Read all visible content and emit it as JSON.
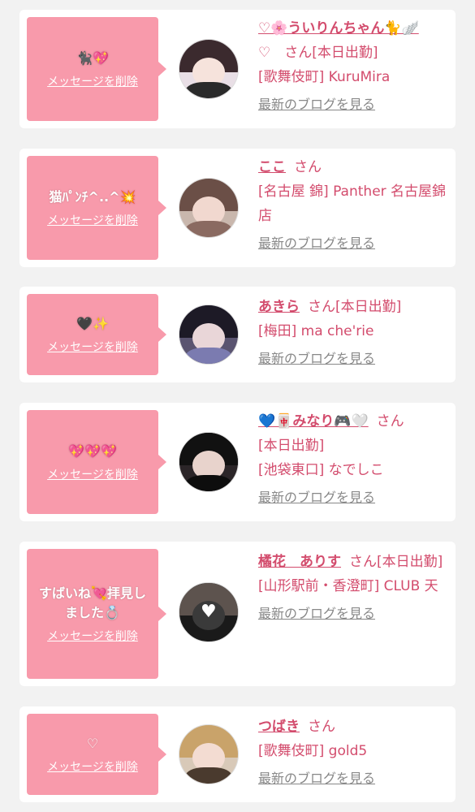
{
  "delete_label": "メッセージを削除",
  "blog_label": "最新のブログを見る",
  "honorific": "さん",
  "colors": {
    "accent": "#f89aab",
    "text": "#d34c6d",
    "link_gray": "#888888"
  },
  "messages": [
    {
      "bubble_text": "🐈‍⬛💖",
      "name": "♡🌸ういりんちゃん🐈🪽",
      "status_line": "♡　さん[本日出勤]",
      "shop_line": "[歌舞伎町] KuruMira",
      "avatar_icon": "portrait-icon"
    },
    {
      "bubble_text": "猫ﾊﾟﾝﾁ^..^💥",
      "name": "ここ",
      "status_line": "",
      "shop_line": "[名古屋 錦] Panther 名古屋錦店",
      "avatar_icon": "portrait-icon"
    },
    {
      "bubble_text": "🖤✨",
      "name": "あきら",
      "status_line": "[本日出勤]",
      "shop_line": "[梅田] ma che'rie",
      "avatar_icon": "portrait-icon"
    },
    {
      "bubble_text": "💖💖💖",
      "name": "💙🀄みなり🎮🤍",
      "status_line": "[本日出勤]",
      "shop_line": "[池袋東口] なでしこ",
      "avatar_icon": "portrait-icon"
    },
    {
      "bubble_text": "すばいね💘拝見しました💍",
      "name": "橘花　ありす",
      "status_line": "[本日出勤]",
      "shop_line": "[山形駅前・香澄町] CLUB 天",
      "avatar_icon": "portrait-icon"
    },
    {
      "bubble_text": "♡",
      "name": "つばき",
      "status_line": "",
      "shop_line": "[歌舞伎町] gold5",
      "avatar_icon": "portrait-icon"
    }
  ]
}
